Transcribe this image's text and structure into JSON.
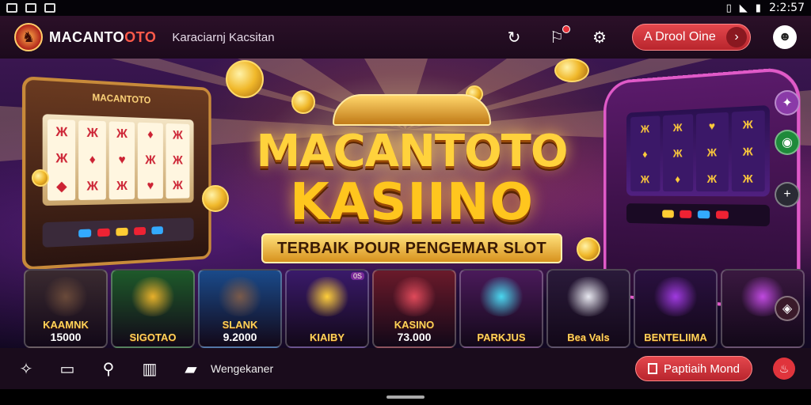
{
  "status_bar": {
    "time": "2:2:57",
    "icons": [
      "photo-icon",
      "image-icon",
      "app-icon"
    ],
    "right_icons": [
      "vibrate-icon",
      "wifi-icon",
      "battery-icon"
    ]
  },
  "header": {
    "brand_prefix": "MACANTO",
    "brand_accent": "OTO",
    "subtitle": "Karaciarnj Kacsitan",
    "actions": [
      "refresh-icon",
      "notification-icon",
      "settings-icon"
    ],
    "cta_label": "A  Drool Oine",
    "cta_arrow": "›",
    "avatar_icon": "user-icon"
  },
  "hero": {
    "title_line1": "MACANTOTO",
    "title_line2": "KASIINO",
    "ribbon": "TERBAIK POUR PENGEMAR SLOT",
    "left_machine_label": "MACANTOTO",
    "left_reels": [
      [
        "Ж",
        "Ж",
        "◆"
      ],
      [
        "Ж",
        "♦",
        "Ж"
      ],
      [
        "Ж",
        "♥",
        "Ж"
      ],
      [
        "♦",
        "Ж",
        "♥"
      ],
      [
        "Ж",
        "Ж",
        "Ж"
      ]
    ],
    "right_reels": [
      [
        "Ж",
        "♦",
        "Ж"
      ],
      [
        "Ж",
        "Ж",
        "♦"
      ],
      [
        "♥",
        "Ж",
        "Ж"
      ],
      [
        "Ж",
        "Ж",
        "Ж"
      ]
    ],
    "cards": [
      {
        "name": "KAAMNK",
        "amount": "15000",
        "color": "#3a2a30",
        "art": "#6a4a3a",
        "badge": ""
      },
      {
        "name": "SIGOTAO",
        "amount": "",
        "color": "#1e5a2a",
        "art": "#e8b02a",
        "badge": ""
      },
      {
        "name": "SLANK",
        "amount": "9.2000",
        "color": "#1a4a8a",
        "art": "#7a5a4a",
        "badge": ""
      },
      {
        "name": "KIAIBY",
        "amount": "",
        "color": "#3a1a6a",
        "art": "#ffcf3a",
        "badge": "0S"
      },
      {
        "name": "KASINO",
        "amount": "73.000",
        "color": "#6a1a2a",
        "art": "#e04a5a",
        "badge": ""
      },
      {
        "name": "PARKJUS",
        "amount": "",
        "color": "#4a1a5a",
        "art": "#4ad8f0",
        "badge": ""
      },
      {
        "name": "Bea Vals",
        "amount": "",
        "color": "#2a1a3a",
        "art": "#e8e8f0",
        "badge": ""
      },
      {
        "name": "BENTELIIMA",
        "amount": "",
        "color": "#2a1040",
        "art": "#a03ae0",
        "badge": ""
      },
      {
        "name": "",
        "amount": "",
        "color": "#3a1840",
        "art": "#c04ae0",
        "badge": ""
      }
    ],
    "side_buttons": [
      {
        "icon": "magic-icon",
        "bg": "#8a3aa8"
      },
      {
        "icon": "chat-icon",
        "bg": "#1e8a3a"
      },
      {
        "icon": "plus-icon",
        "bg": "#2a2a34"
      },
      {
        "icon": "game-icon",
        "bg": "#3a1a2a"
      }
    ]
  },
  "bottom_bar": {
    "icons": [
      "puzzle-icon",
      "card-icon",
      "search-icon",
      "grid-icon",
      "bag-icon"
    ],
    "label": "Wengekaner",
    "cta_label": "Paptiaih Mond",
    "fab_icon": "fire-icon"
  }
}
